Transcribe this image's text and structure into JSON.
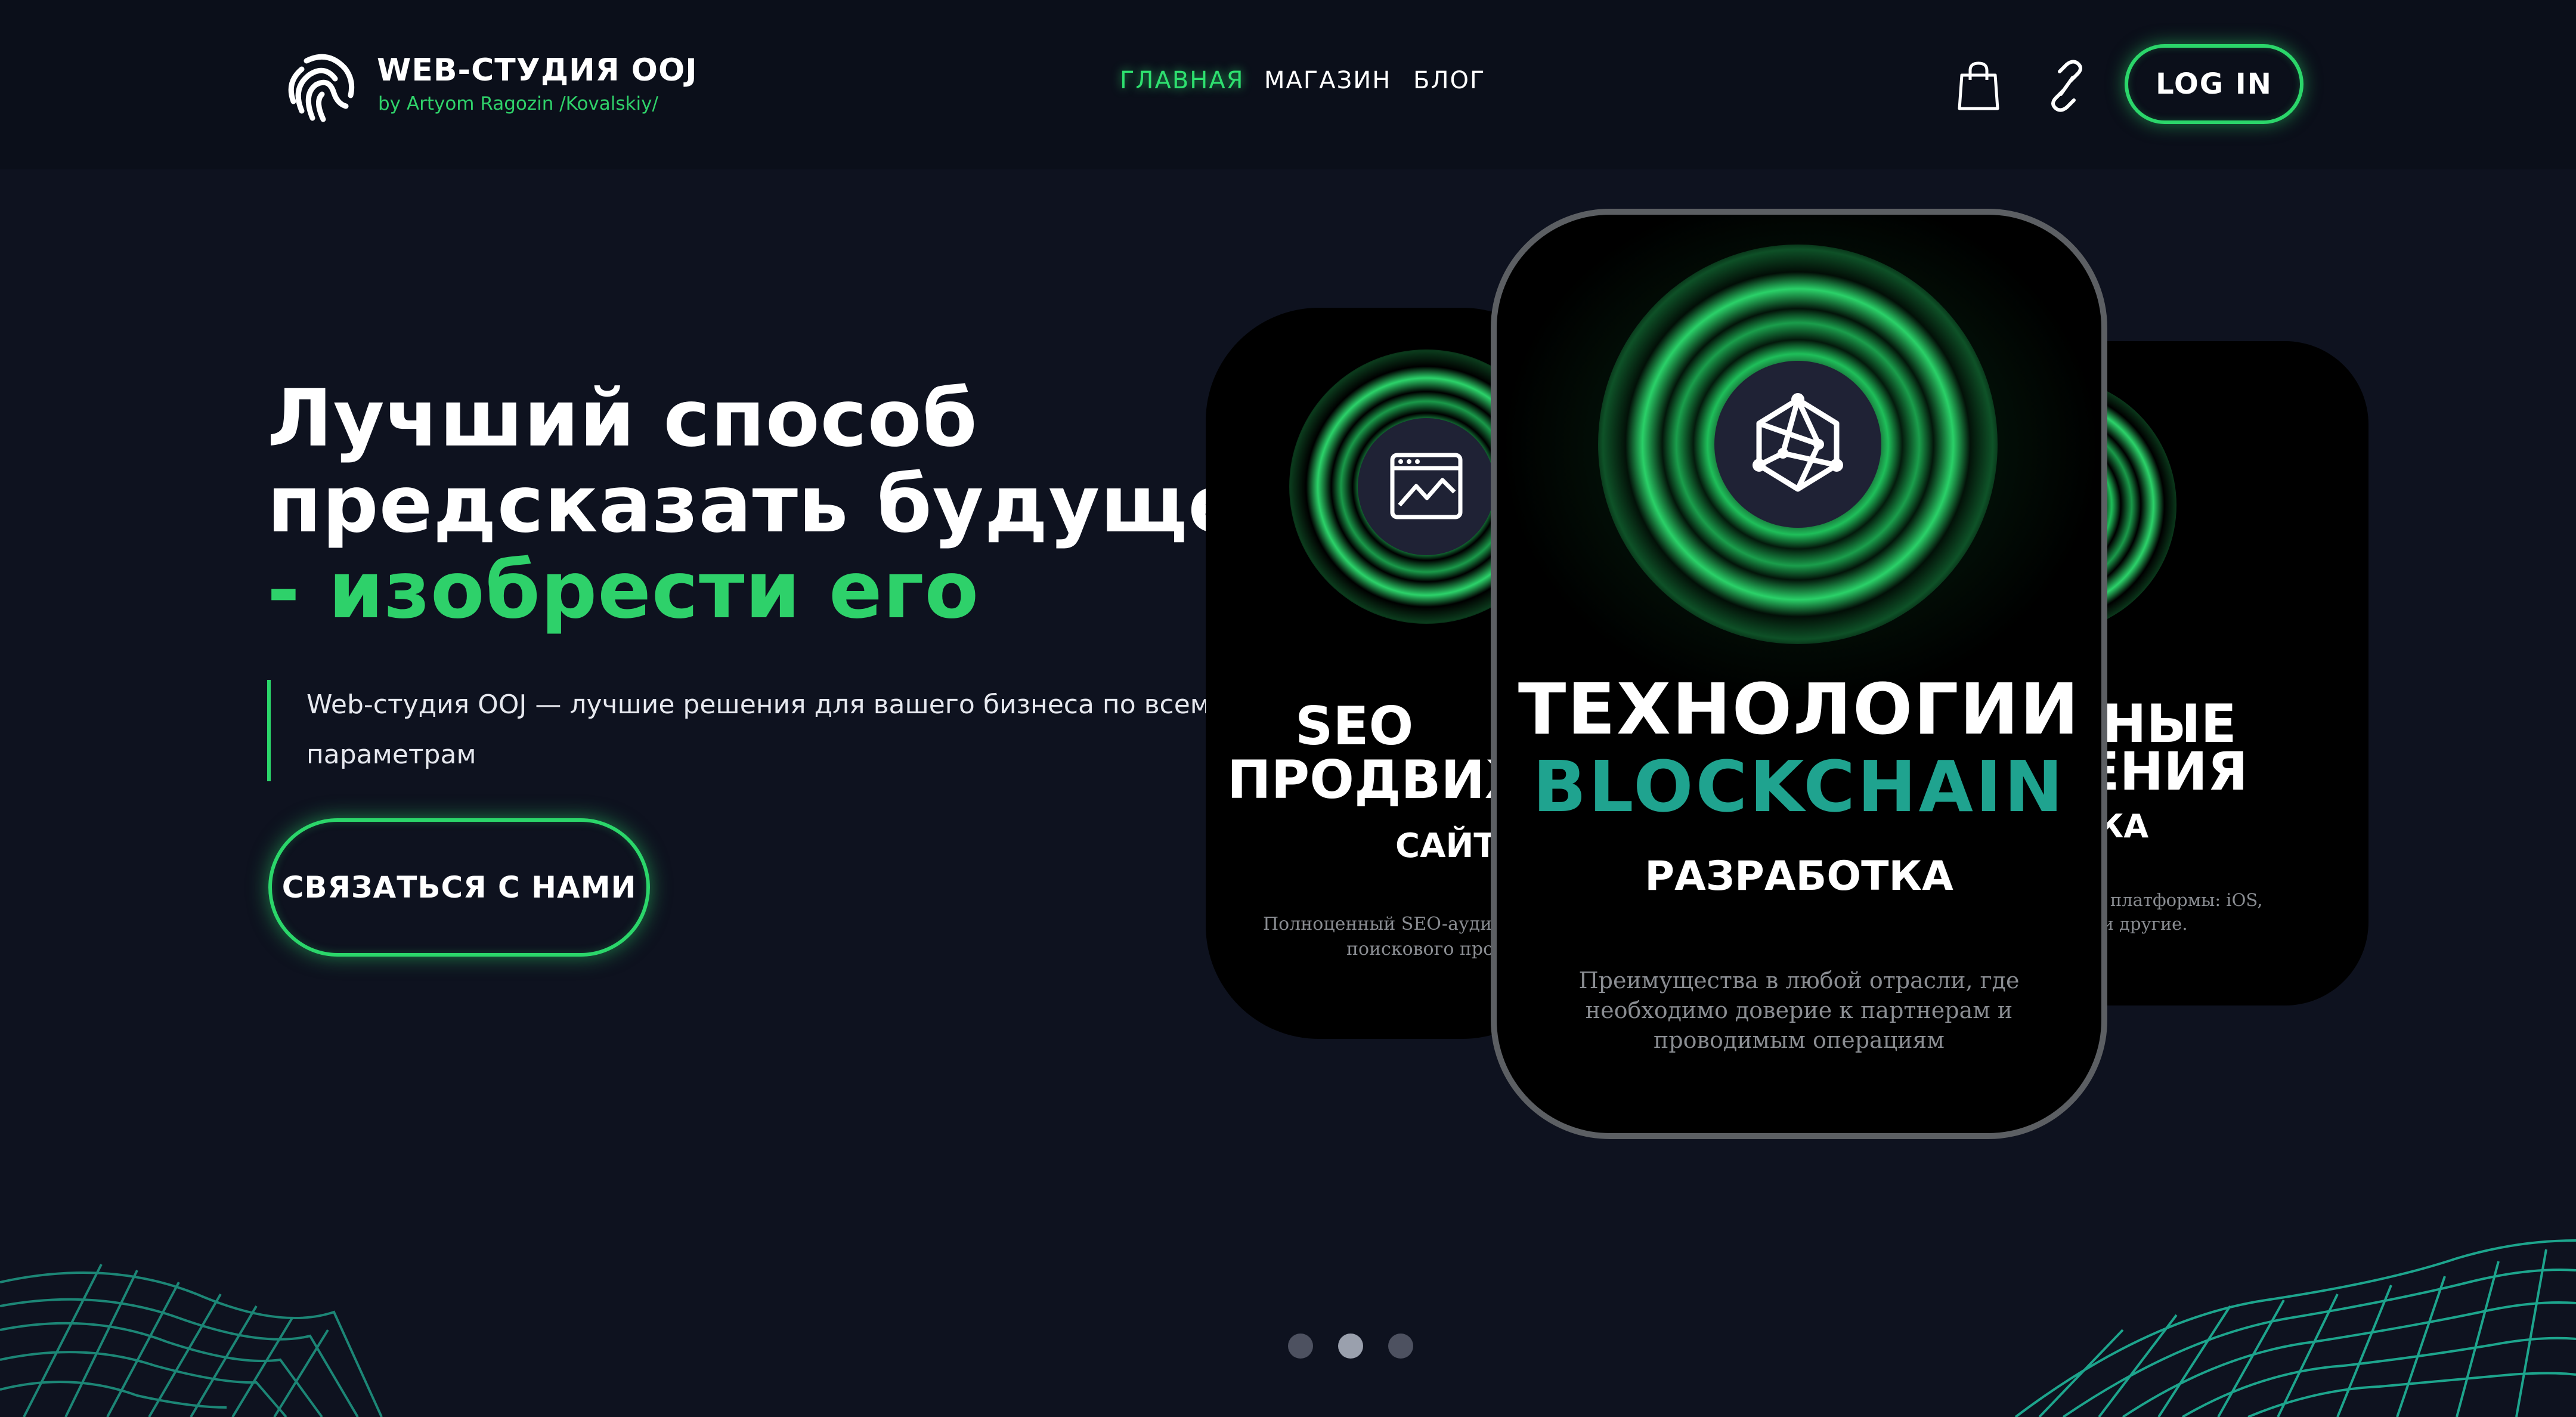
{
  "brand": {
    "title": "WEB-СТУДИЯ OOJ",
    "subtitle": "by Artyom Ragozin /Kovalskiy/"
  },
  "nav": {
    "items": [
      {
        "label": "ГЛАВНАЯ",
        "active": true
      },
      {
        "label": "МАГАЗИН",
        "active": false
      },
      {
        "label": "БЛОГ",
        "active": false
      }
    ]
  },
  "header_actions": {
    "cart_icon": "shopping-bag-icon",
    "link_icon": "link-icon",
    "login_label": "LOG IN"
  },
  "hero": {
    "title_line1": "Лучший способ",
    "title_line2": "предсказать будущее",
    "title_line3": "- изобрести его",
    "description": "Web-студия OOJ — лучшие решения для вашего бизнеса по всем параметрам",
    "cta_label": "СВЯЗАТЬСЯ С НАМИ"
  },
  "cards": {
    "left": {
      "icon": "browser-chart-icon",
      "title_line1": "SEO",
      "title_line2": "ПРОДВИЖ",
      "subtitle": "САЙТА",
      "text_line1": "Полноценный SEO-аудит сай",
      "text_line2": "поискового продв"
    },
    "main": {
      "icon": "blockchain-cube-icon",
      "title_line1": "ТЕХНОЛОГИИ",
      "title_line2": "BLOCKCHAIN",
      "subtitle": "РАЗРАБОТКА",
      "text_line1": "Преимущества в любой отрасли, где",
      "text_line2": "необходимо доверие к партнерам и",
      "text_line3": "проводимым операциям"
    },
    "right": {
      "icon": "app-store-icon",
      "title_line1": "ИЛЬНЫЕ",
      "title_line2": "ОЖЕНИЯ",
      "subtitle": "РАБОТКА",
      "text_line1": "та под разные платформы: iOS,",
      "text_line2": "indows Phone и другие."
    }
  },
  "slider": {
    "count": 3,
    "active_index": 1
  },
  "colors": {
    "background": "#0e121f",
    "header": "#0b0f1a",
    "accent_green": "#2bd66a",
    "accent_teal": "#1fa38f",
    "card_border": "#5c5f63"
  }
}
